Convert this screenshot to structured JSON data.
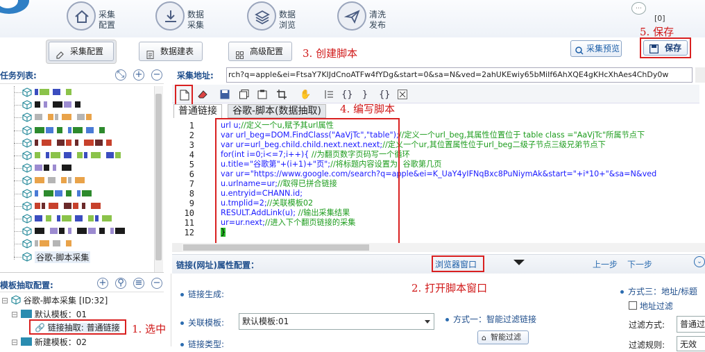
{
  "topbar": {
    "nav": [
      {
        "line1": "采集",
        "line2": "配置",
        "icon": "home-icon"
      },
      {
        "line1": "数据",
        "line2": "采集",
        "icon": "download-icon"
      },
      {
        "line1": "数据",
        "line2": "浏览",
        "icon": "layers-icon"
      },
      {
        "line1": "清洗",
        "line2": "发布",
        "icon": "send-icon"
      }
    ],
    "counter": "[0]"
  },
  "subtabs": [
    "采集配置",
    "数据建表",
    "高级配置"
  ],
  "buttons": {
    "preview": "采集预览",
    "save": "保存"
  },
  "annotations": {
    "a1": "1. 选中",
    "a2": "2. 打开脚本窗口",
    "a3": "3. 创建脚本",
    "a4": "4. 编写脚本",
    "a5": "5. 保存"
  },
  "tasklist": {
    "header": "任务列表:",
    "last_item": "谷歌-脚本采集"
  },
  "url": {
    "label": "采集地址:",
    "value": "rch?q=apple&ei=FtsaY7KIJdCnoATFw4fYDg&start=0&sa=N&ved=2ahUKEwiy65bMiIf6AhXQE4gKHcXhAes4ChDy0w"
  },
  "editor": {
    "tabs": [
      "普通链接",
      "谷歌-脚本(数据抽取)"
    ],
    "line_numbers": [
      "1",
      "2",
      "3",
      "4",
      "5",
      "6",
      "7",
      "8",
      "9",
      "10",
      "11",
      "12"
    ],
    "lines": [
      {
        "code": "url u;",
        "comment": "//定义一个u,赋予其url属性"
      },
      {
        "code": "var url_beg=DOM.FindClass(\"AaVjTc\",\"table\");",
        "comment": "//定义一个url_beg,其属性位置位于 table class =\"AaVjTc\"所属节点下"
      },
      {
        "code": "var ur=url_beg.child.child.next.next.next;",
        "comment": "//定义一个ur,其位置属性位于url_beg二级子节点三级兄弟节点下"
      },
      {
        "code": "for(int i=0;i<=7;i++){",
        "comment": "  //为翻页数字页码写一个循环"
      },
      {
        "code": "u.title=\"谷歌第\"+(i+1)+\"页\";",
        "comment": "//将标题内容设置为: 谷歌第几页"
      },
      {
        "code": "var ur=\"https://www.google.com/search?q=apple&ei=K_UaY4yIFNqBxc8PuNiymAk&start=\"+i*10+\"&sa=N&ved",
        "comment": ""
      },
      {
        "code": "u.urlname=ur;",
        "comment": "//取得已拼合链接"
      },
      {
        "code": "u.entryid=CHANN.id;",
        "comment": ""
      },
      {
        "code": "u.tmplid=2;",
        "comment": "//关联模板02"
      },
      {
        "code": "RESULT.AddLink(u);",
        "comment": " //输出采集结果"
      },
      {
        "code": "ur=ur.next;",
        "comment": "//进入下个翻页链接的采集"
      },
      {
        "code": "}",
        "comment": ""
      }
    ]
  },
  "props": {
    "header": "链接(网址)属性配置：",
    "browser_window": "浏览器窗口",
    "prev": "上一步",
    "next": "下一步",
    "link_gen": "链接生成:",
    "assoc_tmpl": "关联模板:",
    "assoc_tmpl_value": "默认模板:01",
    "link_type": "链接类型:",
    "method1": "方式一：智能过滤链接",
    "smart_filter": "智能过滤",
    "method3": "方式三：地址/标题",
    "addr_filter": "地址过滤",
    "filter_mode": "过滤方式:",
    "filter_mode_value": "普通过",
    "filter_rule": "过滤规则:",
    "filter_rule_value": "无效"
  },
  "template": {
    "header": "模板抽取配置:",
    "root": "谷歌-脚本采集 [ID:32]",
    "default_tmpl": "默认模板：01",
    "link_extract": "链接抽取: 普通链接",
    "new_tmpl": "新建模板：02"
  },
  "colors": {
    "accent": "#1f4e8c",
    "annotation": "#d01818",
    "code_keyword": "#1a1aff",
    "code_comment": "#1d9c1d"
  }
}
